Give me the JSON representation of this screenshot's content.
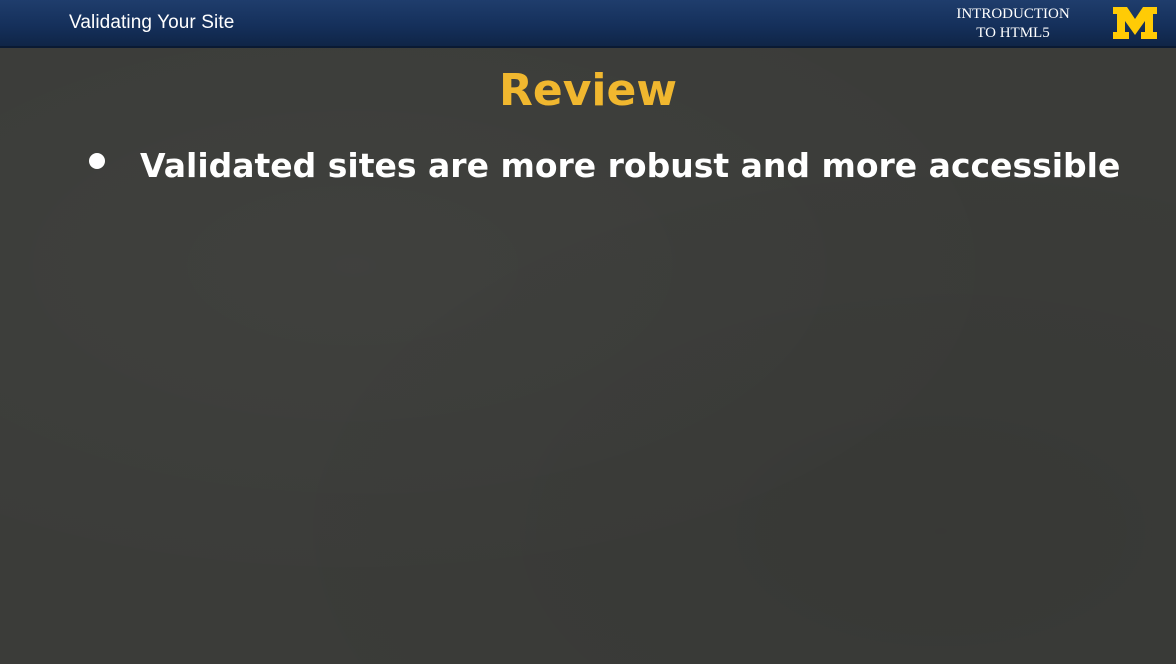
{
  "header": {
    "title": "Validating Your Site",
    "course_line1": "INTRODUCTION",
    "course_line2": "TO HTML5",
    "logo_letter": "M",
    "bar_color": "#15305b"
  },
  "slide": {
    "heading": "Review",
    "heading_color": "#f0b72f",
    "bullets": [
      "Validated sites are more robust and more accessible"
    ]
  },
  "icons": {
    "logo": "block-m-logo-icon",
    "bullet": "bullet-dot-icon"
  }
}
